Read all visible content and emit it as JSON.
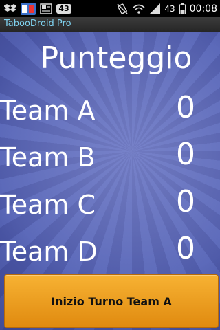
{
  "status_bar": {
    "notification_icons": [
      "dropbox-icon",
      "app-icon",
      "news-icon"
    ],
    "notification_count": "43",
    "battery_text": "43",
    "time": "00:08"
  },
  "app": {
    "title": "TabooDroid Pro"
  },
  "score": {
    "heading": "Punteggio",
    "teams": [
      {
        "name": "Team A",
        "score": "0"
      },
      {
        "name": "Team B",
        "score": "0"
      },
      {
        "name": "Team C",
        "score": "0"
      },
      {
        "name": "Team D",
        "score": "0"
      }
    ]
  },
  "actions": {
    "start_turn_label": "Inizio Turno Team A"
  },
  "colors": {
    "background": "#5060b0",
    "button": "#f0a020",
    "title_text": "#7fd3f0"
  }
}
